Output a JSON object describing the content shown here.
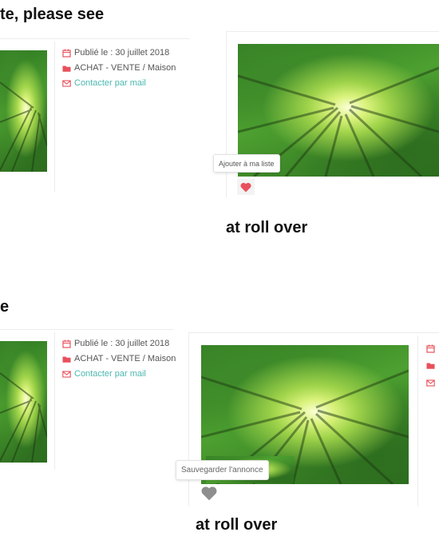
{
  "headings": {
    "top": "te, please see",
    "roll_over_1": "at roll over",
    "middle": "e",
    "roll_over_2": "at roll over"
  },
  "listing_meta": {
    "published": "Publié le : 30 juillet 2018",
    "category": "ACHAT - VENTE / Maison",
    "contact": "Contacter par mail"
  },
  "tooltips": {
    "add_to_list": "Ajouter à ma liste",
    "save_ad": "Sauvegarder l'annonce"
  },
  "colors": {
    "accent_red": "#e8505b",
    "contact_teal": "#4bb8b0",
    "heart_grey": "#8e8e8e"
  },
  "icons": {
    "calendar": "calendar-icon",
    "folder": "folder-icon",
    "mail": "mail-icon",
    "heart": "heart-icon"
  }
}
